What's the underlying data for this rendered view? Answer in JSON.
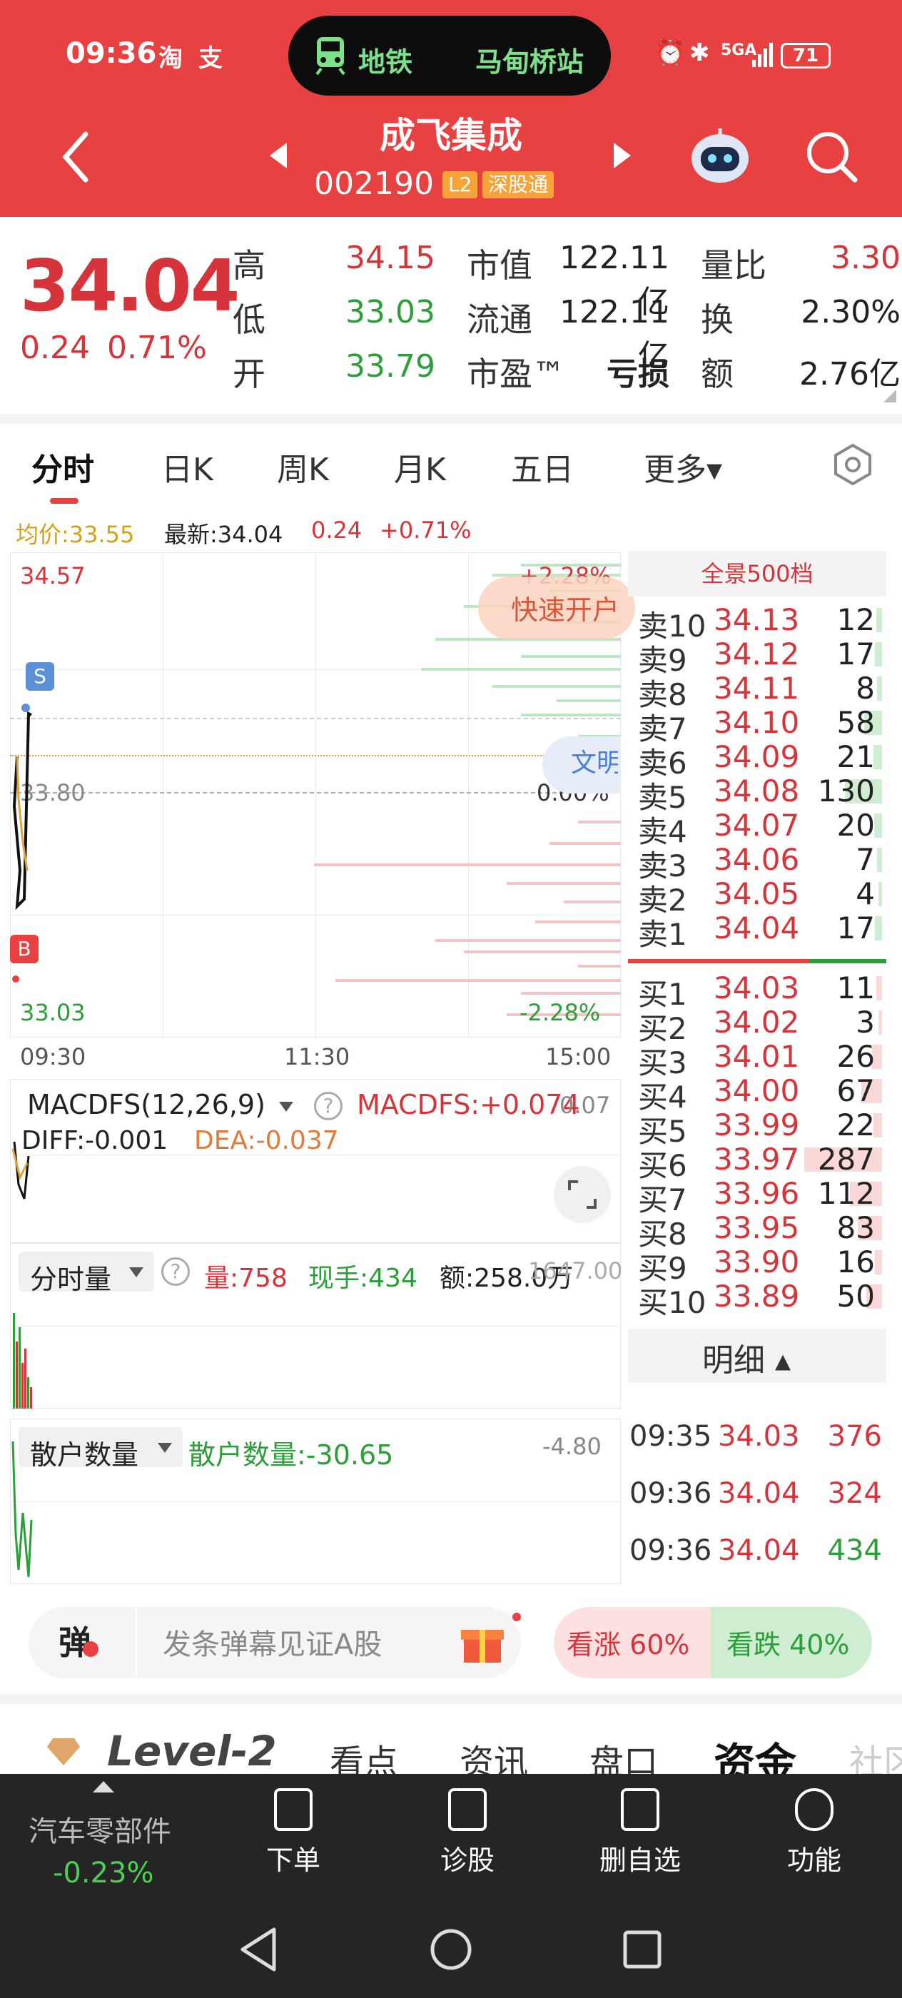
{
  "status_bar": {
    "time": "09:36",
    "battery": "71",
    "network": "5GA"
  },
  "live_activity": {
    "mode": "地铁",
    "station": "马甸桥站"
  },
  "header": {
    "stock_name": "成飞集成",
    "stock_code": "002190",
    "badge_l2": "L2",
    "badge_exchange": "深股通"
  },
  "quote": {
    "price": "34.04",
    "change": "0.24",
    "change_pct": "0.71%",
    "high_label": "高",
    "high": "34.15",
    "low_label": "低",
    "low": "33.03",
    "open_label": "开",
    "open": "33.79",
    "mcap_label": "市值",
    "mcap": "122.11亿",
    "float_label": "流通",
    "float": "122.11亿",
    "pe_label": "市盈™",
    "pe": "亏损",
    "vr_label": "量比",
    "vr": "3.30",
    "turnover_label": "换",
    "turnover": "2.30%",
    "amount_label": "额",
    "amount": "2.76亿"
  },
  "tabs": [
    "分时",
    "日K",
    "周K",
    "月K",
    "五日",
    "更多▾"
  ],
  "chart_header": {
    "avg": "均价:33.55",
    "latest": "最新:34.04",
    "chg": "0.24",
    "chg_pct": "+0.71%"
  },
  "chart": {
    "y_high": "34.57",
    "y_mid": "33.80",
    "y_low": "33.03",
    "pct_high": "+2.28%",
    "pct_mid": "0.00%",
    "pct_low": "-2.28%",
    "fast_open": "快速开户",
    "wenming": "文明",
    "marker_s": "S",
    "marker_b": "B",
    "times": [
      "09:30",
      "11:30",
      "15:00"
    ]
  },
  "macd": {
    "name": "MACDFS(12,26,9)",
    "value": "MACDFS:+0.074",
    "diff": "DIFF:-0.001",
    "dea": "DEA:-0.037",
    "scale": "0.07"
  },
  "volume": {
    "name": "分时量",
    "vol": "量:758",
    "hand": "现手:434",
    "amt": "额:258.0万",
    "scale": "1647.00"
  },
  "retail": {
    "name": "散户数量",
    "value": "散户数量:-30.65",
    "scale": "-4.80"
  },
  "orderbook": {
    "title": "全景500档",
    "sells": [
      {
        "n": "卖10",
        "p": "34.13",
        "q": "12"
      },
      {
        "n": "卖9",
        "p": "34.12",
        "q": "17"
      },
      {
        "n": "卖8",
        "p": "34.11",
        "q": "8"
      },
      {
        "n": "卖7",
        "p": "34.10",
        "q": "58"
      },
      {
        "n": "卖6",
        "p": "34.09",
        "q": "21"
      },
      {
        "n": "卖5",
        "p": "34.08",
        "q": "130"
      },
      {
        "n": "卖4",
        "p": "34.07",
        "q": "20"
      },
      {
        "n": "卖3",
        "p": "34.06",
        "q": "7"
      },
      {
        "n": "卖2",
        "p": "34.05",
        "q": "4"
      },
      {
        "n": "卖1",
        "p": "34.04",
        "q": "17"
      }
    ],
    "buys": [
      {
        "n": "买1",
        "p": "34.03",
        "q": "11"
      },
      {
        "n": "买2",
        "p": "34.02",
        "q": "3"
      },
      {
        "n": "买3",
        "p": "34.01",
        "q": "26"
      },
      {
        "n": "买4",
        "p": "34.00",
        "q": "67"
      },
      {
        "n": "买5",
        "p": "33.99",
        "q": "22"
      },
      {
        "n": "买6",
        "p": "33.97",
        "q": "287"
      },
      {
        "n": "买7",
        "p": "33.96",
        "q": "112"
      },
      {
        "n": "买8",
        "p": "33.95",
        "q": "83"
      },
      {
        "n": "买9",
        "p": "33.90",
        "q": "16"
      },
      {
        "n": "买10",
        "p": "33.89",
        "q": "50"
      }
    ]
  },
  "detail": {
    "title": "明细 ▴",
    "rows": [
      {
        "t": "09:35",
        "p": "34.03",
        "q": "376"
      },
      {
        "t": "09:36",
        "p": "34.04",
        "q": "324"
      },
      {
        "t": "09:36",
        "p": "34.04",
        "q": "434"
      }
    ]
  },
  "danmu": {
    "icon": "弹",
    "placeholder": "发条弹幕见证A股",
    "up": "看涨 60%",
    "down": "看跌 40%"
  },
  "lower_tabs": [
    "Level-2",
    "看点",
    "资讯",
    "盘口",
    "资金",
    "社区"
  ],
  "bottom_nav": {
    "sector": "汽车零部件",
    "sector_chg": "-0.23%",
    "items": [
      "下单",
      "诊股",
      "删自选",
      "功能"
    ]
  }
}
